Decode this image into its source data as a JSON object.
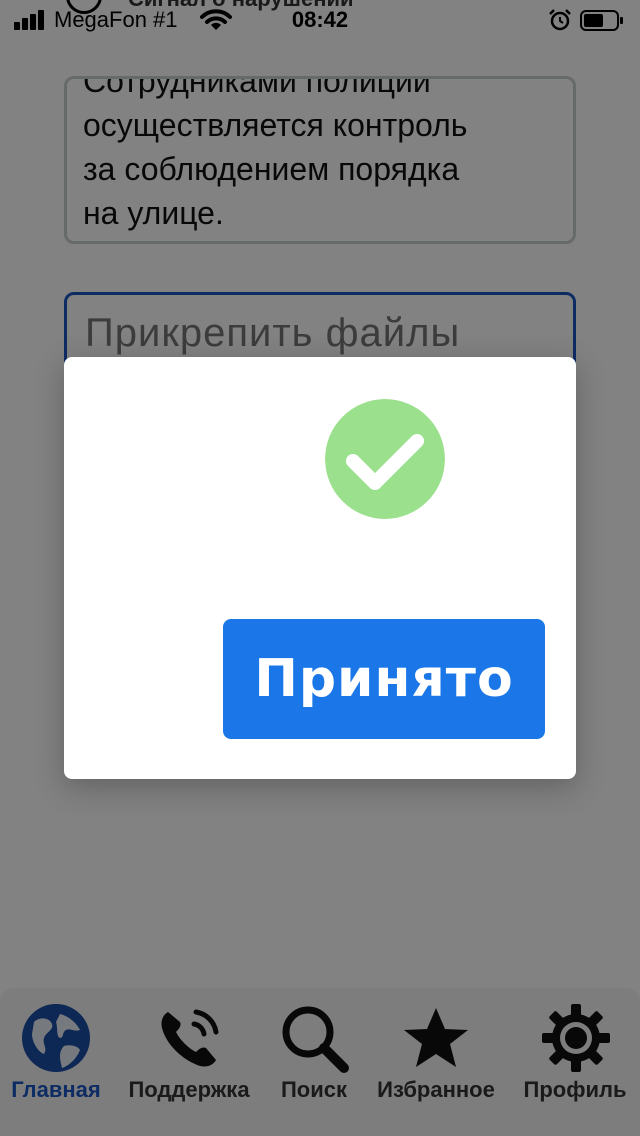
{
  "status_bar": {
    "carrier": "MegaFon #1",
    "time": "08:42",
    "icons": [
      "signal-icon",
      "wifi-icon",
      "alarm-icon",
      "battery-icon"
    ]
  },
  "form": {
    "title_partial": "Сигнал о нарушении",
    "description_lines": [
      "Сотрудниками полиции",
      "осуществляется контроль",
      "за соблюдением порядка",
      "на улице."
    ],
    "attach_label": "Прикрепить файлы"
  },
  "dialog": {
    "icon": "check-circle-icon",
    "button_label": "Принято"
  },
  "tabbar": {
    "items": [
      {
        "label": "Главная",
        "icon": "globe-icon",
        "active": true
      },
      {
        "label": "Поддержка",
        "icon": "phone-icon",
        "active": false
      },
      {
        "label": "Поиск",
        "icon": "search-icon",
        "active": false
      },
      {
        "label": "Избранное",
        "icon": "star-icon",
        "active": false
      },
      {
        "label": "Профиль",
        "icon": "gear-icon",
        "active": false
      }
    ]
  },
  "colors": {
    "accent": "#1b77e8",
    "success": "#9be08c",
    "active_tab": "#1a56c4",
    "focus_border": "#1a56c4"
  }
}
